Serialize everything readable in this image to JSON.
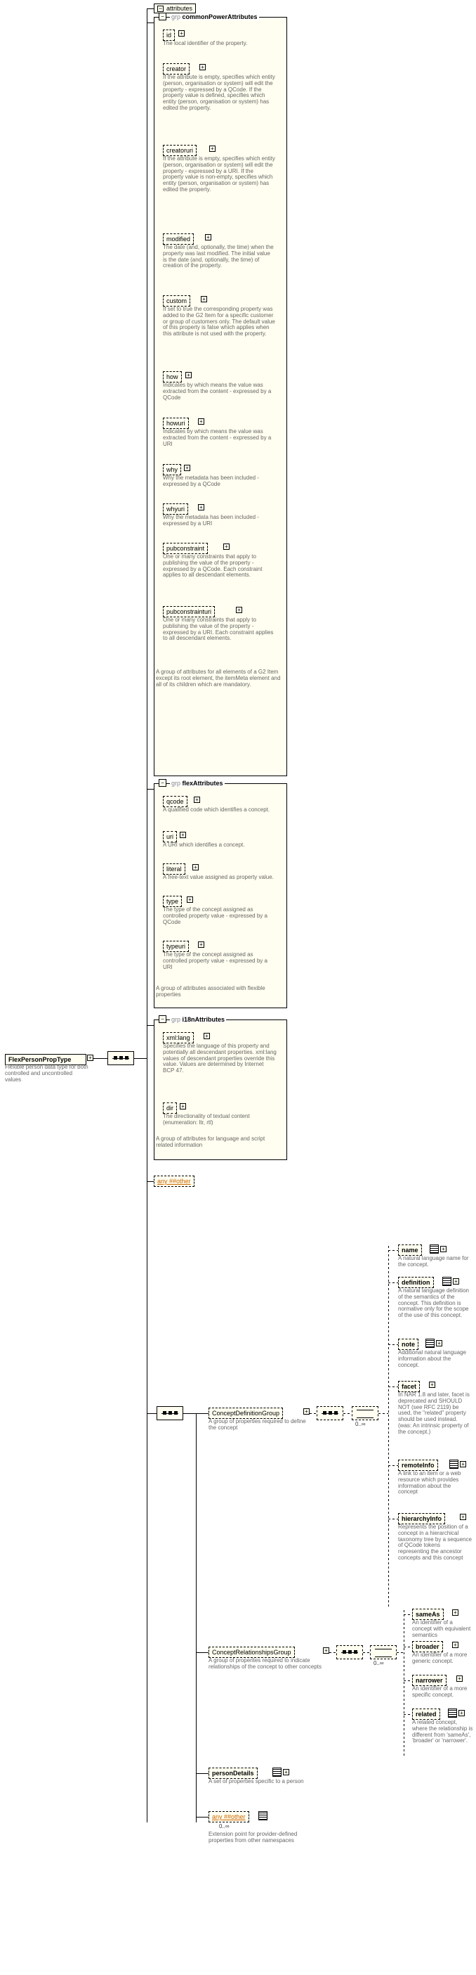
{
  "root": {
    "name": "FlexPersonPropType",
    "desc": "Flexible person data type for both controlled and uncontrolled values"
  },
  "attr_section_label": "attributes",
  "any_attr": "any ##other",
  "groups": [
    {
      "prefix": "grp",
      "name": "commonPowerAttributes",
      "desc": "A group of attributes for all elements of a G2 Item except its root element, the itemMeta element and all of its children which are mandatory.",
      "items": [
        {
          "name": "id",
          "desc": "The local identifier of the property."
        },
        {
          "name": "creator",
          "desc": "If the attribute is empty, specifies which entity (person, organisation or system) will edit the property - expressed by a QCode. If the property value is defined, specifies which entity (person, organisation or system) has edited the property."
        },
        {
          "name": "creatoruri",
          "desc": "If the attribute is empty, specifies which entity (person, organisation or system) will edit the property - expressed by a URI. If the property value is non-empty, specifies which entity (person, organisation or system) has edited the property."
        },
        {
          "name": "modified",
          "desc": "The date (and, optionally, the time) when the property was last modified. The initial value is the date (and, optionally, the time) of creation of the property."
        },
        {
          "name": "custom",
          "desc": "If set to true the corresponding property was added to the G2 Item for a specific customer or group of customers only. The default value of this property is false which applies when this attribute is not used with the property."
        },
        {
          "name": "how",
          "desc": "Indicates by which means the value was extracted from the content - expressed by a QCode"
        },
        {
          "name": "howuri",
          "desc": "Indicates by which means the value was extracted from the content - expressed by a URI"
        },
        {
          "name": "why",
          "desc": "Why the metadata has been included - expressed by a QCode"
        },
        {
          "name": "whyuri",
          "desc": "Why the metadata has been included - expressed by a URI"
        },
        {
          "name": "pubconstraint",
          "desc": "One or many constraints that apply to publishing the value of the property - expressed by a QCode. Each constraint applies to all descendant elements."
        },
        {
          "name": "pubconstrainturi",
          "desc": "One or many constraints that apply to publishing the value of the property - expressed by a URI. Each constraint applies to all descendant elements."
        }
      ]
    },
    {
      "prefix": "grp",
      "name": "flexAttributes",
      "desc": "A group of attributes associated with flexible properties",
      "items": [
        {
          "name": "qcode",
          "desc": "A qualified code which identifies a concept."
        },
        {
          "name": "uri",
          "desc": "A URI which identifies a concept."
        },
        {
          "name": "literal",
          "desc": "A free-text value assigned as property value."
        },
        {
          "name": "type",
          "desc": "The type of the concept assigned as controlled property value - expressed by a QCode"
        },
        {
          "name": "typeuri",
          "desc": "The type of the concept assigned as controlled property value - expressed by a URI"
        }
      ]
    },
    {
      "prefix": "grp",
      "name": "i18nAttributes",
      "desc": "A group of attributes for language and script related information",
      "items": [
        {
          "name": "xml:lang",
          "desc": "Specifies the language of this property and potentially all descendant properties. xml:lang values of descendant properties override this value. Values are determined by Internet BCP 47."
        },
        {
          "name": "dir",
          "desc": "The directionality of textual content (enumeration: ltr, rtl)"
        }
      ]
    }
  ],
  "elem_groups": [
    {
      "name": "ConceptDefinitionGroup",
      "desc": "A group of properties required to define the concept",
      "card": "0..∞",
      "items": [
        {
          "name": "name",
          "desc": "A natural language name for the concept."
        },
        {
          "name": "definition",
          "desc": "A natural language definition of the semantics of the concept. This definition is normative only for the scope of the use of this concept."
        },
        {
          "name": "note",
          "desc": "Additional natural language information about the concept."
        },
        {
          "name": "facet",
          "desc": "In NAR 1.8 and later, facet is deprecated and SHOULD NOT (see RFC 2119) be used, the \"related\" property should be used instead. (was: An intrinsic property of the concept.)"
        },
        {
          "name": "remoteInfo",
          "desc": "A link to an item or a web resource which provides information about the concept"
        },
        {
          "name": "hierarchyInfo",
          "desc": "Represents the position of a concept in a hierarchical taxonomy tree by a sequence of QCode tokens representing the ancestor concepts and this concept"
        }
      ]
    },
    {
      "name": "ConceptRelationshipsGroup",
      "desc": "A group of properites required to indicate relationships of the concept to other concepts",
      "card": "0..∞",
      "items": [
        {
          "name": "sameAs",
          "desc": "An identifier of a concept with equivalent semantics"
        },
        {
          "name": "broader",
          "desc": "An identifier of a more generic concept."
        },
        {
          "name": "narrower",
          "desc": "An identifier of a more specific concept."
        },
        {
          "name": "related",
          "desc": "A related concept, where the relationship is different from 'sameAs', 'broader' or 'narrower'."
        }
      ]
    }
  ],
  "person": {
    "name": "personDetails",
    "desc": "A set of properties specific to a person"
  },
  "any_elem": {
    "label": "any ##other",
    "card": "0..∞",
    "desc": "Extension point for provider-defined properties from other namespaces"
  }
}
